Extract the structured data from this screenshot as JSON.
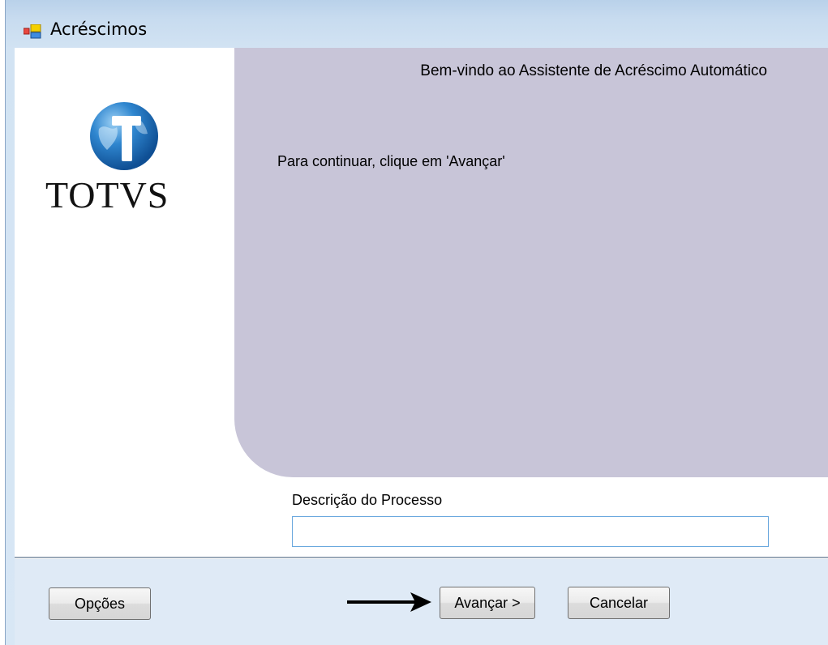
{
  "window": {
    "title": "Acréscimos",
    "icon": "app-window-icon"
  },
  "brand": {
    "logo_icon": "totvs-globe-logo",
    "name": "TOTVS"
  },
  "wizard": {
    "welcome_title": "Bem-vindo ao Assistente de Acréscimo Automático",
    "instruction": "Para continuar, clique em 'Avançar'",
    "panel_color": "#c8c5d8"
  },
  "process": {
    "label": "Descrição do Processo",
    "value": ""
  },
  "footer": {
    "options_label": "Opções",
    "next_label": "Avançar >",
    "cancel_label": "Cancelar",
    "pointer_icon": "right-arrow-icon"
  },
  "colors": {
    "titlebar": "#c7dbef",
    "footer": "#dfeaf6",
    "input_border": "#6aa8de"
  }
}
